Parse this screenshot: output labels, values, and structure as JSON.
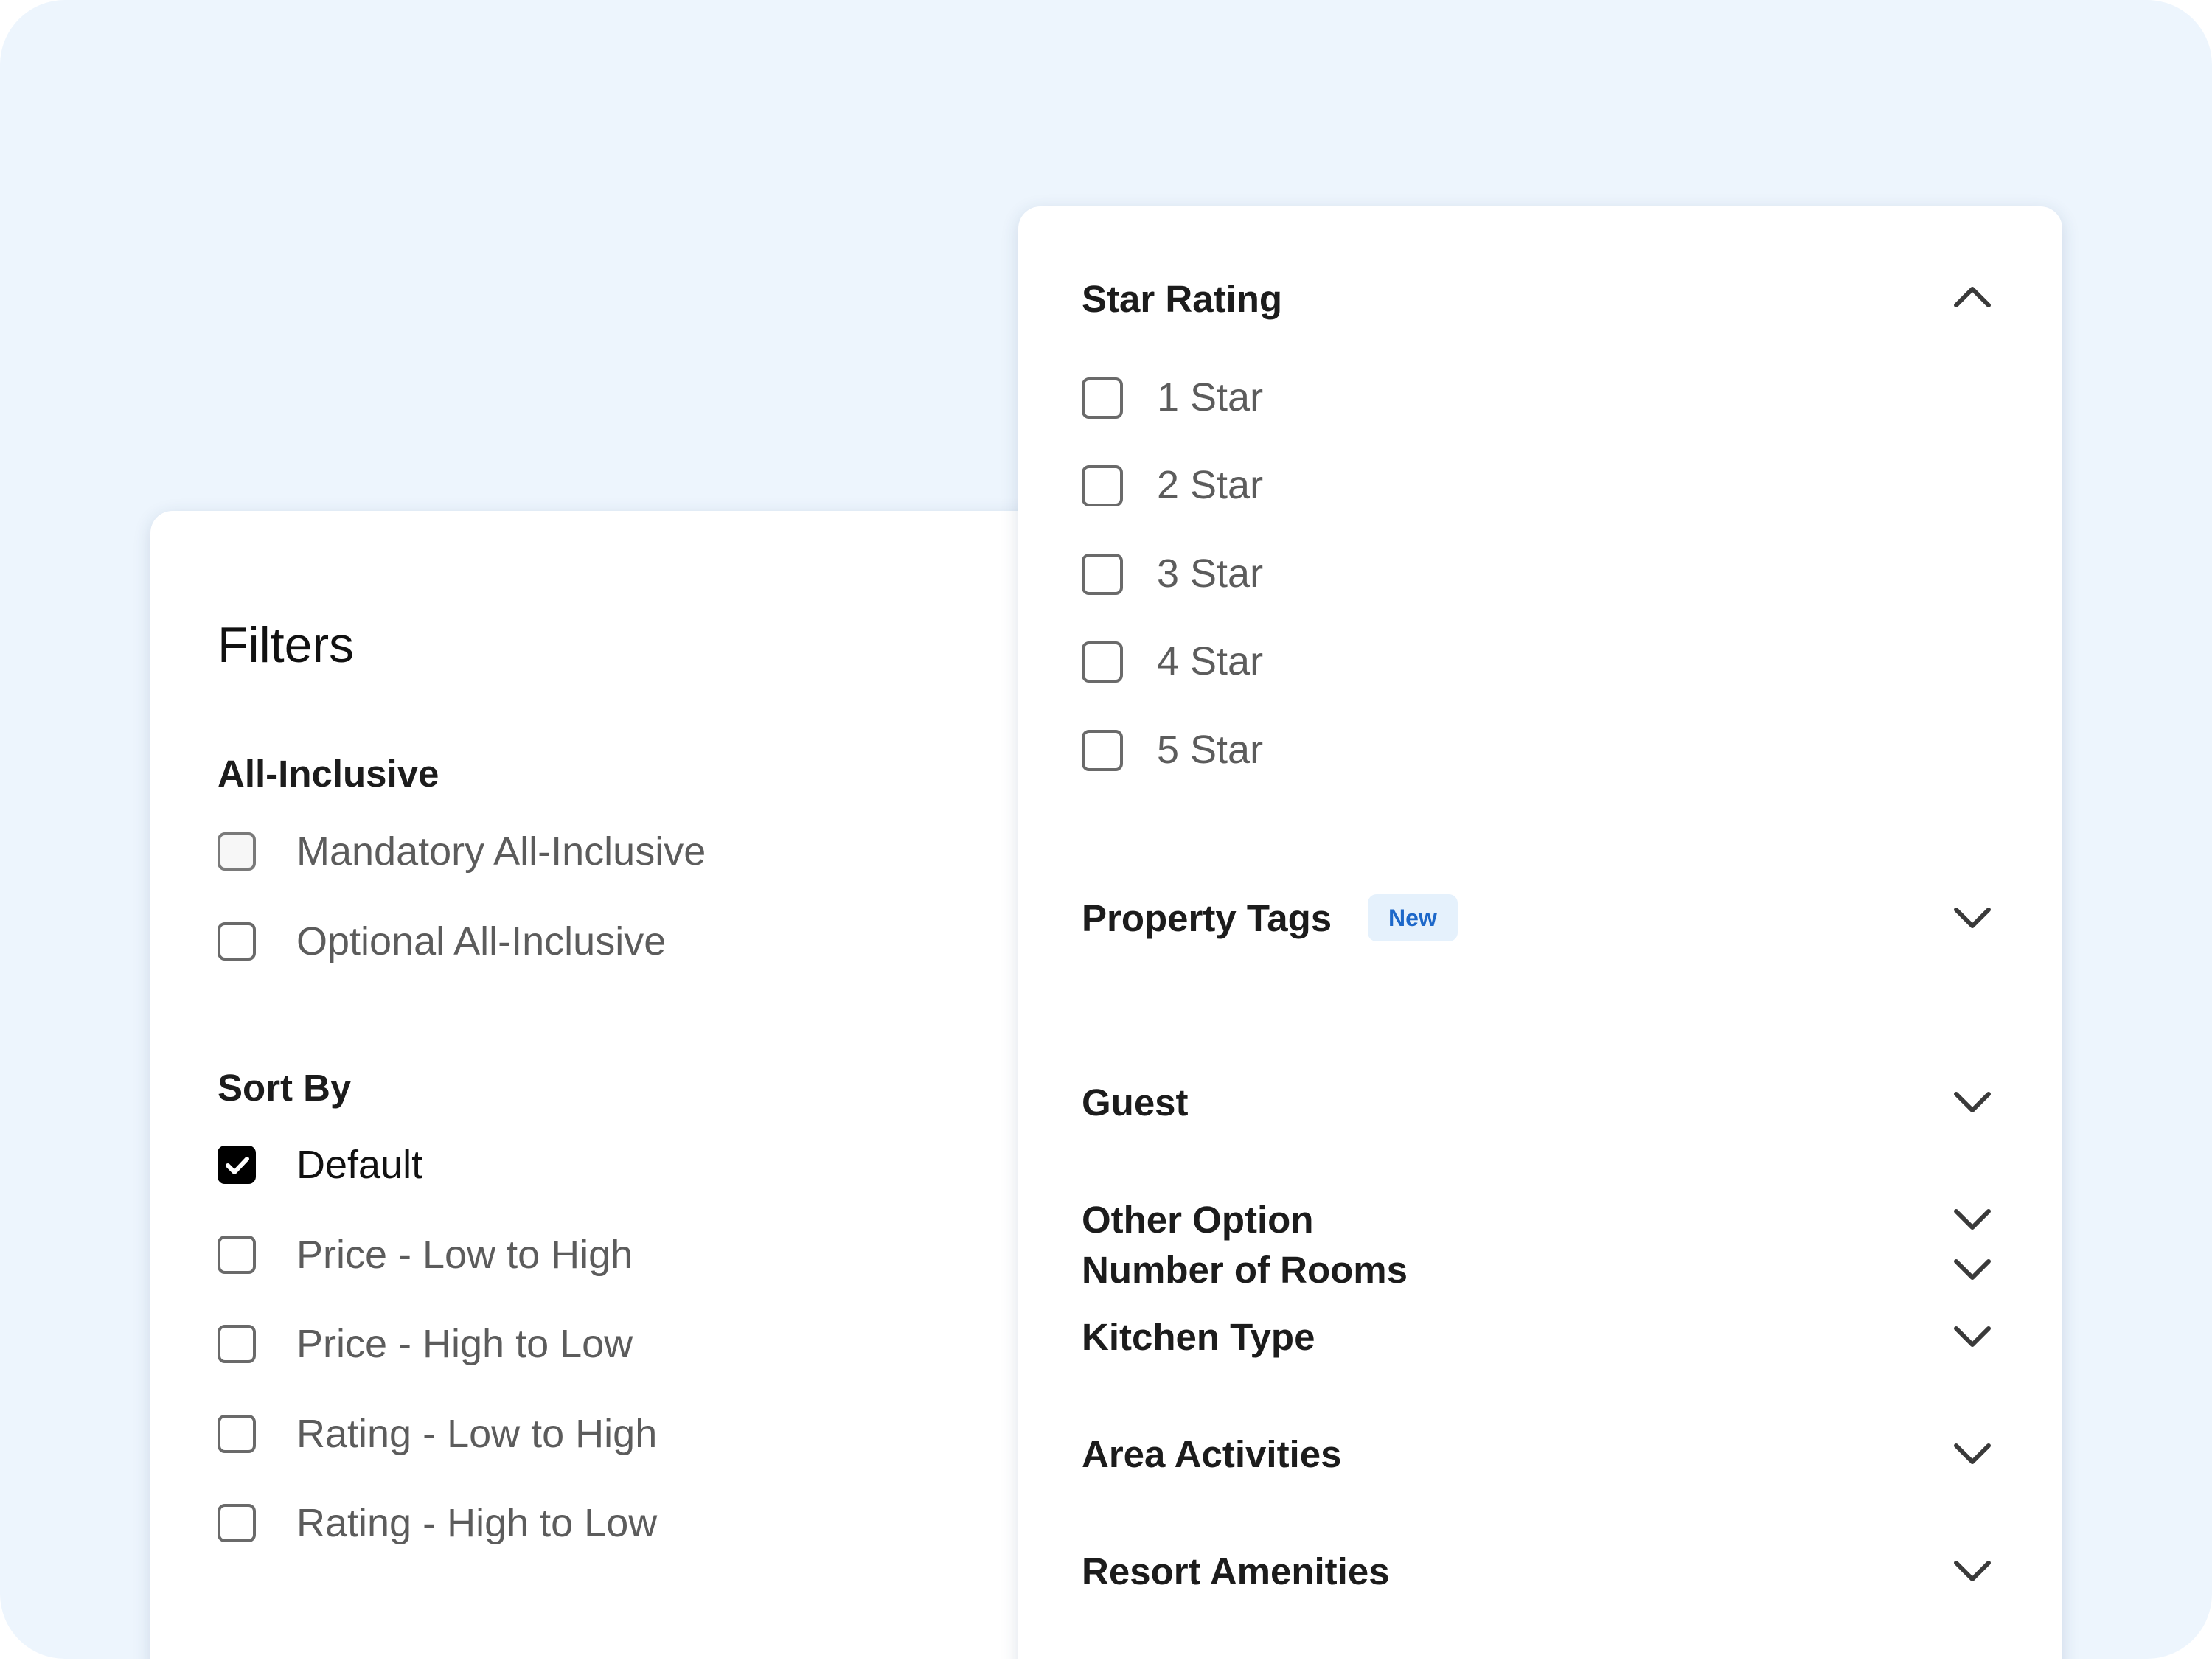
{
  "left_panel": {
    "title": "Filters",
    "all_inclusive": {
      "heading": "All-Inclusive",
      "options": [
        {
          "label": "Mandatory All-Inclusive",
          "checked": false
        },
        {
          "label": "Optional All-Inclusive",
          "checked": false
        }
      ]
    },
    "sort_by": {
      "heading": "Sort By",
      "options": [
        {
          "label": "Default",
          "checked": true
        },
        {
          "label": "Price - Low to High",
          "checked": false
        },
        {
          "label": "Price - High to Low",
          "checked": false
        },
        {
          "label": "Rating - Low to High",
          "checked": false
        },
        {
          "label": "Rating - High to Low",
          "checked": false
        }
      ]
    }
  },
  "right_panel": {
    "star_rating": {
      "heading": "Star Rating",
      "expanded": true,
      "icon": "chevron-up-icon",
      "options": [
        {
          "label": "1 Star",
          "checked": false
        },
        {
          "label": "2 Star",
          "checked": false
        },
        {
          "label": "3 Star",
          "checked": false
        },
        {
          "label": "4 Star",
          "checked": false
        },
        {
          "label": "5 Star",
          "checked": false
        }
      ]
    },
    "sections": [
      {
        "label": "Property Tags",
        "badge": "New",
        "expanded": false,
        "icon": "chevron-down-icon"
      },
      {
        "label": "Guest",
        "expanded": false,
        "icon": "chevron-down-icon"
      },
      {
        "label": "Other Option",
        "expanded": false,
        "icon": "chevron-down-icon"
      },
      {
        "label": "Number of Rooms",
        "expanded": false,
        "icon": "chevron-down-icon"
      },
      {
        "label": "Kitchen Type",
        "expanded": false,
        "icon": "chevron-down-icon"
      },
      {
        "label": "Area Activities",
        "expanded": false,
        "icon": "chevron-down-icon"
      },
      {
        "label": "Resort Amenities",
        "expanded": false,
        "icon": "chevron-down-icon"
      }
    ]
  },
  "colors": {
    "background": "#edf5fd",
    "card": "#ffffff",
    "checkbox_checked": "#000000",
    "badge_bg": "#e5f1fc",
    "badge_text": "#1d68c9"
  }
}
